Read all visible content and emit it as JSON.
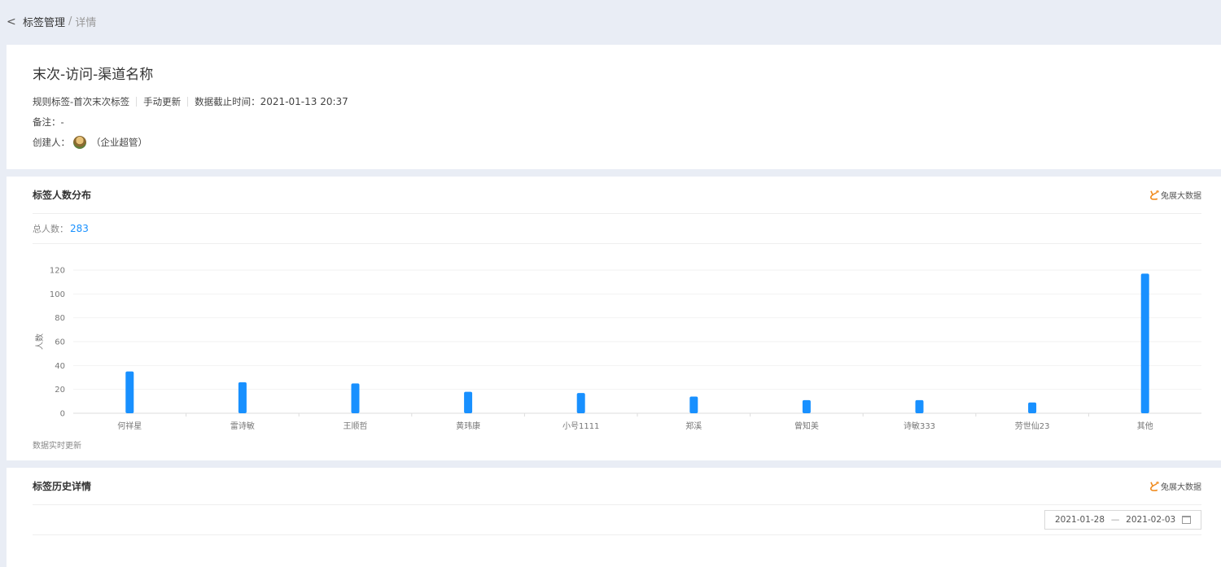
{
  "breadcrumb": {
    "parent": "标签管理",
    "separator": "/",
    "current": "详情"
  },
  "tag": {
    "title": "末次-访问-渠道名称",
    "type": "规则标签-首次末次标签",
    "update_mode": "手动更新",
    "data_cutoff_label": "数据截止时间：",
    "data_cutoff": "2021-01-13 20:37",
    "remark_label": "备注：",
    "remark": "-",
    "creator_label": "创建人：",
    "creator_role": "（企业超管）"
  },
  "distribution": {
    "title": "标签人数分布",
    "brand": "兔展大数据",
    "total_label": "总人数：",
    "total": "283",
    "footnote": "数据实时更新"
  },
  "chart_data": {
    "type": "bar",
    "categories": [
      "何祥星",
      "雷诗敏",
      "王顺哲",
      "黄玮康",
      "小号1111",
      "郑溪",
      "曾知美",
      "诗敏333",
      "劳世仙23",
      "其他"
    ],
    "values": [
      35,
      26,
      25,
      18,
      17,
      14,
      11,
      11,
      9,
      117
    ],
    "ylabel": "人数",
    "ylim": [
      0,
      120
    ],
    "yticks": [
      0,
      20,
      40,
      60,
      80,
      100,
      120
    ],
    "grid": true,
    "bar_color": "#1890ff"
  },
  "history": {
    "title": "标签历史详情",
    "brand": "兔展大数据",
    "date_start": "2021-01-28",
    "date_sep": "—",
    "date_end": "2021-02-03"
  }
}
